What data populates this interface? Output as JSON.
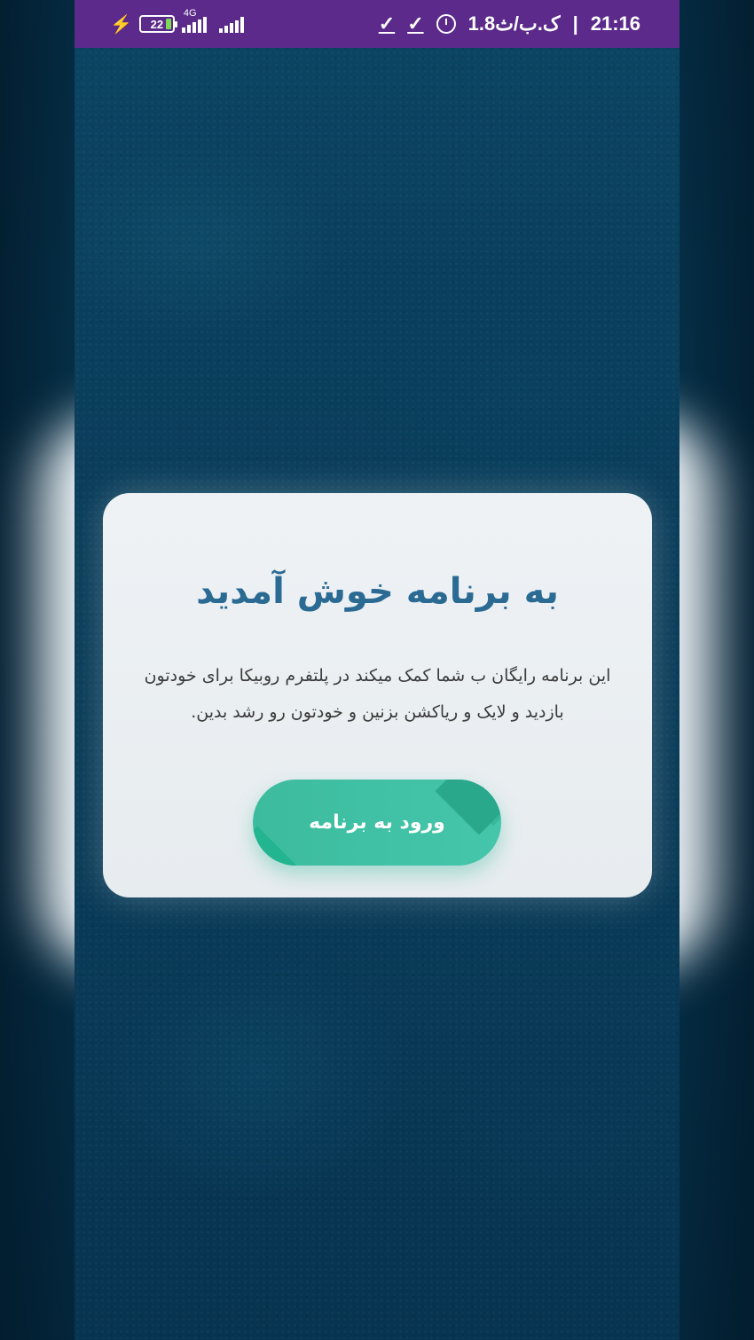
{
  "status_bar": {
    "time": "21:16",
    "separator": "|",
    "data_speed": "1.8ک.ب/ث",
    "battery_level": "22",
    "network_type": "4G",
    "icons": [
      "charging-icon",
      "battery-icon",
      "signal-4g-icon",
      "signal-icon",
      "alarm-icon",
      "check-icon",
      "check-icon"
    ],
    "background_color": "#5b2a8a"
  },
  "welcome_card": {
    "title": "به برنامه خوش آمدید",
    "description": "این برنامه رایگان ب شما کمک میکند در پلتفرم روبیکا برای خودتون بازدید و لایک و ریاکشن بزنین و خودتون رو رشد بدین.",
    "enter_button_label": "ورود به برنامه",
    "title_color": "#2a6a93",
    "button_color": "#41c2a6"
  }
}
